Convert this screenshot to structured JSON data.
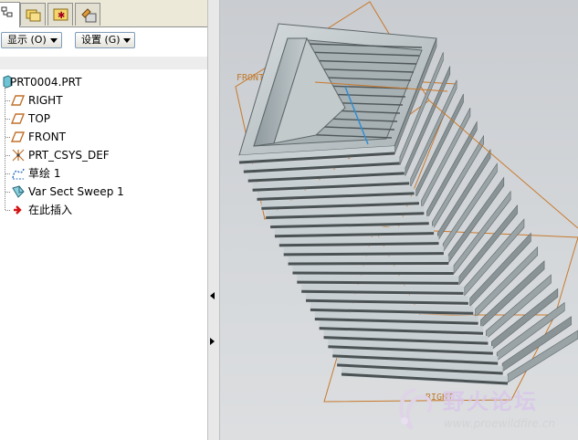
{
  "tabs": [
    {
      "name": "model-tree",
      "icon": "model-tree-icon",
      "active": true
    },
    {
      "name": "folder-browser",
      "icon": "folder-browser-icon",
      "active": false
    },
    {
      "name": "favorites",
      "icon": "favorites-folder-icon",
      "active": false
    },
    {
      "name": "connections",
      "icon": "connections-icon",
      "active": false
    }
  ],
  "toolbar": {
    "show_label": "显示 (O)",
    "settings_label": "设置 (G)"
  },
  "tree": {
    "root": {
      "label": "PRT0004.PRT",
      "icon": "part-icon"
    },
    "items": [
      {
        "label": "RIGHT",
        "icon": "datum-plane-icon"
      },
      {
        "label": "TOP",
        "icon": "datum-plane-icon"
      },
      {
        "label": "FRONT",
        "icon": "datum-plane-icon"
      },
      {
        "label": "PRT_CSYS_DEF",
        "icon": "coordinate-system-icon"
      },
      {
        "label": "草绘 1",
        "icon": "sketch-icon"
      },
      {
        "label": "Var Sect Sweep 1",
        "icon": "var-sect-sweep-icon"
      },
      {
        "label": "在此插入",
        "icon": "insert-here-arrow-icon"
      }
    ]
  },
  "viewport": {
    "datum_labels": {
      "front": "FRONT",
      "right": "RIGHT"
    },
    "colors": {
      "datum": "#c8782a",
      "surface_light": "#c9d0d3",
      "surface_dark": "#4a5254",
      "accent_line": "#2f8fd6"
    }
  },
  "watermark": {
    "text_cn": "野火论坛",
    "url": "www.proewildfire.cn"
  }
}
